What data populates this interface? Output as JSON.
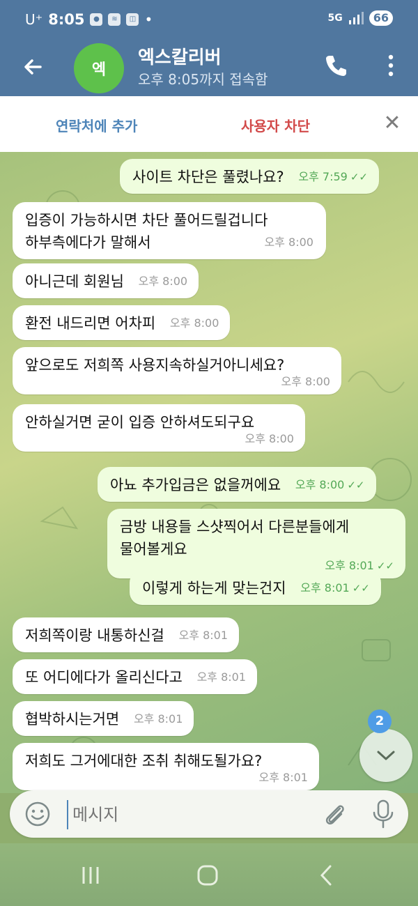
{
  "status_bar": {
    "carrier": "U⁺",
    "time": "8:05",
    "network": "5G",
    "battery": "66"
  },
  "header": {
    "back_label": "←",
    "avatar_text": "엑",
    "name": "엑스칼리버",
    "status": "오후 8:05까지 접속함"
  },
  "action_bar": {
    "add_contact": "연락처에 추가",
    "block_user": "사용자 차단",
    "close": "✕"
  },
  "messages": [
    {
      "dir": "out",
      "text": "사이트 차단은 풀렸나요?",
      "time": "오후 7:59"
    },
    {
      "dir": "in",
      "text": "입증이 가능하시면 차단 풀어드릴겁니다\n하부측에다가 말해서",
      "time": "오후 8:00"
    },
    {
      "dir": "in",
      "text": "아니근데 회원님",
      "time": "오후 8:00"
    },
    {
      "dir": "in",
      "text": "환전 내드리면 어차피",
      "time": "오후 8:00"
    },
    {
      "dir": "in",
      "text": "앞으로도 저희쪽 사용지속하실거아니세요?",
      "time": "오후 8:00"
    },
    {
      "dir": "in",
      "text": "안하실거면 굳이 입증 안하셔도되구요",
      "time": "오후 8:00"
    },
    {
      "dir": "out",
      "text": "아뇨 추가입금은 없을꺼에요",
      "time": "오후 8:00"
    },
    {
      "dir": "out",
      "text": "금방 내용들 스샷찍어서 다른분들에게\n물어볼게요",
      "time": "오후 8:01"
    },
    {
      "dir": "out",
      "text": "이렇게 하는게 맞는건지",
      "time": "오후 8:01"
    },
    {
      "dir": "in",
      "text": "저희쪽이랑 내통하신걸",
      "time": "오후 8:01"
    },
    {
      "dir": "in",
      "text": "또 어디에다가 올리신다고",
      "time": "오후 8:01"
    },
    {
      "dir": "in",
      "text": "협박하시는거면",
      "time": "오후 8:01"
    },
    {
      "dir": "in",
      "text": "저희도 그거에대한 조취 취해도될가요?",
      "time": "오후 8:01"
    }
  ],
  "unread_count": "2",
  "composer": {
    "placeholder": "메시지"
  },
  "colors": {
    "header": "#50779f",
    "outgoing_bubble": "#effdde",
    "incoming_bubble": "#ffffff",
    "accent": "#4d84b8",
    "danger": "#d24a4a",
    "read_check": "#53a856"
  },
  "icons": [
    "back-arrow-icon",
    "phone-icon",
    "more-vertical-icon",
    "close-icon",
    "emoji-icon",
    "attach-icon",
    "mic-icon",
    "chevron-down-icon"
  ]
}
